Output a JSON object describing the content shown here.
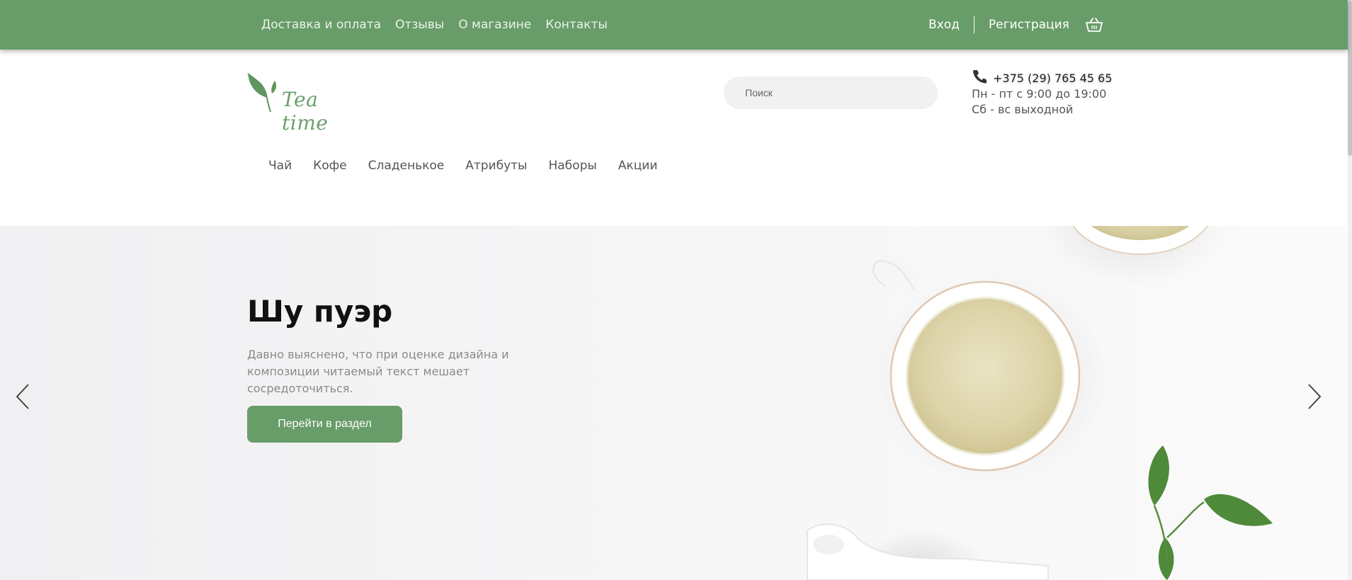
{
  "topbar": {
    "links": [
      "Доставка и оплата",
      "Отзывы",
      "О магазине",
      "Контакты"
    ],
    "login": "Вход",
    "register": "Регистрация",
    "cart_icon": "basket-icon",
    "color": "#689c68"
  },
  "logo": {
    "text": "Tea time"
  },
  "search": {
    "placeholder": "Поиск",
    "value": ""
  },
  "contacts": {
    "phone": "+375 (29) 765 45 65",
    "hours_weekday": "Пн - пт с 9:00 до 19:00",
    "hours_weekend": "Сб - вс выходной",
    "phone_icon": "phone-icon"
  },
  "mainnav": [
    "Чай",
    "Кофе",
    "Сладенькое",
    "Атрибуты",
    "Наборы",
    "Акции"
  ],
  "hero": {
    "title": "Шу пуэр",
    "text": "Давно выяснено, что при оценке дизайна и композиции читаемый текст мешает сосредоточиться.",
    "button": "Перейти в раздел",
    "prev_icon": "chevron-left-icon",
    "next_icon": "chevron-right-icon"
  },
  "colors": {
    "accent": "#689c68",
    "hero_bg": "#f4f4f5"
  }
}
